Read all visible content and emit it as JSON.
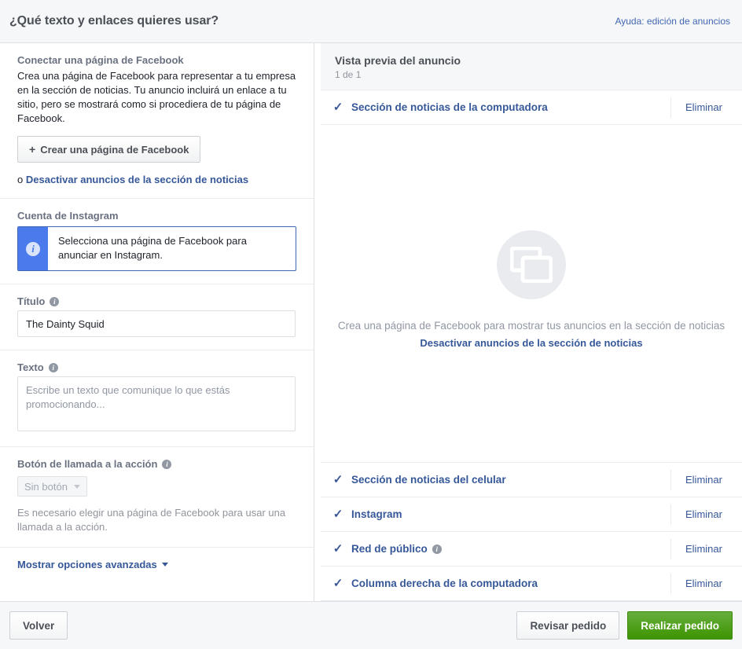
{
  "header": {
    "title": "¿Qué texto y enlaces quieres usar?",
    "help_link": "Ayuda: edición de anuncios"
  },
  "left_panel": {
    "facebook_page": {
      "label": "Conectar una página de Facebook",
      "description": "Crea una página de Facebook para representar a tu empresa en la sección de noticias. Tu anuncio incluirá un enlace a tu sitio, pero se mostrará como si procediera de tu página de Facebook.",
      "create_button": "Crear una página de Facebook",
      "create_button_plus": "+",
      "or_prefix": "o",
      "deactivate_link": "Desactivar anuncios de la sección de noticias"
    },
    "instagram": {
      "label": "Cuenta de Instagram",
      "callout_text": "Selecciona una página de Facebook para anunciar en Instagram.",
      "callout_icon": "info-icon"
    },
    "title_field": {
      "label": "Título",
      "info_icon": "info-icon",
      "value": "The Dainty Squid",
      "placeholder": ""
    },
    "text_field": {
      "label": "Texto",
      "info_icon": "info-icon",
      "value": "",
      "placeholder": "Escribe un texto que comunique lo que estás promocionando..."
    },
    "cta": {
      "label": "Botón de llamada a la acción",
      "info_icon": "info-icon",
      "selected_option": "Sin botón",
      "options": [
        "Sin botón"
      ],
      "note": "Es necesario elegir una página de Facebook para usar una llamada a la acción."
    },
    "advanced": {
      "label": "Mostrar opciones avanzadas",
      "caret_icon": "chevron-down-icon"
    }
  },
  "preview": {
    "title": "Vista previa del anuncio",
    "count": "1 de 1",
    "active_placement": {
      "name": "Sección de noticias de la computadora",
      "check_icon": "check-icon",
      "remove_label": "Eliminar"
    },
    "stage": {
      "placeholder_icon": "image-placeholder-icon",
      "message": "Crea una página de Facebook para mostrar tus anuncios en la sección de noticias",
      "link": "Desactivar anuncios de la sección de noticias"
    },
    "placements": [
      {
        "name": "Sección de noticias del celular",
        "check_icon": "check-icon",
        "remove_label": "Eliminar",
        "has_info": false
      },
      {
        "name": "Instagram",
        "check_icon": "check-icon",
        "remove_label": "Eliminar",
        "has_info": false
      },
      {
        "name": "Red de público",
        "check_icon": "check-icon",
        "remove_label": "Eliminar",
        "has_info": true
      },
      {
        "name": "Columna derecha de la computadora",
        "check_icon": "check-icon",
        "remove_label": "Eliminar",
        "has_info": false
      }
    ]
  },
  "footer": {
    "back_label": "Volver",
    "review_label": "Revisar pedido",
    "place_label": "Realizar pedido"
  },
  "colors": {
    "link_blue": "#365899",
    "brand_blue": "#4267b2",
    "accent_green": "#3d9400",
    "callout_blue": "#4a7aeb"
  }
}
